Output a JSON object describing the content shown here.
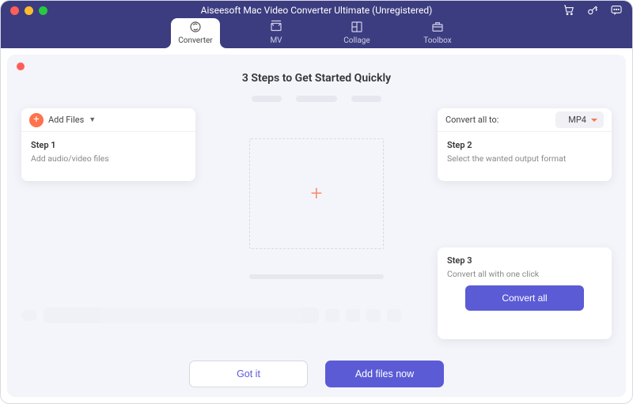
{
  "window": {
    "title": "Aiseesoft Mac Video Converter Ultimate (Unregistered)"
  },
  "header_icons": {
    "cart": "cart-icon",
    "key": "key-icon",
    "feedback": "feedback-icon"
  },
  "tabs": [
    {
      "id": "converter",
      "label": "Converter",
      "icon": "converter-icon",
      "active": true
    },
    {
      "id": "mv",
      "label": "MV",
      "icon": "mv-icon",
      "active": false
    },
    {
      "id": "collage",
      "label": "Collage",
      "icon": "collage-icon",
      "active": false
    },
    {
      "id": "toolbox",
      "label": "Toolbox",
      "icon": "toolbox-icon",
      "active": false
    }
  ],
  "onboarding": {
    "title": "3 Steps to Get Started Quickly",
    "step1": {
      "add_files_label": "Add Files",
      "step_label": "Step 1",
      "description": "Add audio/video files"
    },
    "step2": {
      "convert_to_label": "Convert all to:",
      "format_selected": "MP4",
      "step_label": "Step 2",
      "description": "Select the wanted output format"
    },
    "step3": {
      "step_label": "Step 3",
      "description": "Convert all with one click",
      "button_label": "Convert all"
    },
    "buttons": {
      "got_it": "Got it",
      "add_files_now": "Add files now"
    }
  }
}
